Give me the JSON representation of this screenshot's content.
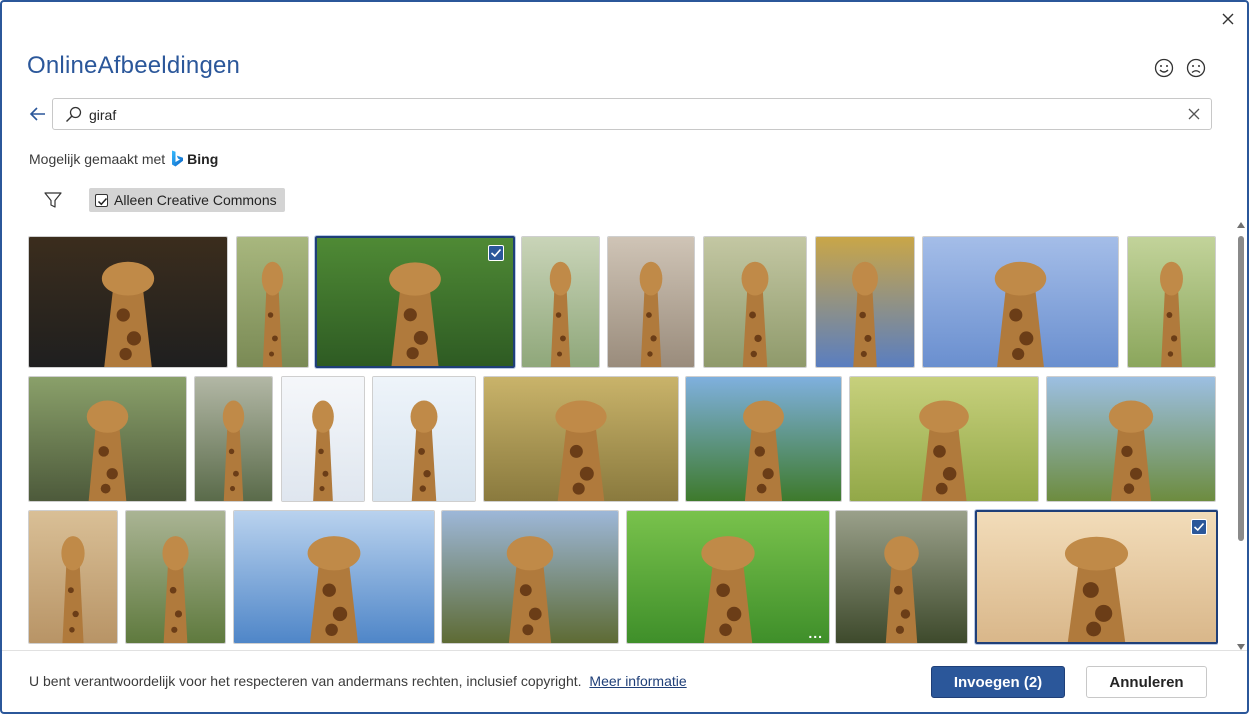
{
  "dialog": {
    "title": "OnlineAfbeeldingen",
    "close_icon": "close-icon",
    "feedback_positive_icon": "smiley-happy-icon",
    "feedback_negative_icon": "smiley-sad-icon"
  },
  "search": {
    "back_icon": "arrow-left-icon",
    "search_icon": "search-icon",
    "query": "giraf",
    "clear_icon": "close-icon"
  },
  "powered_by": {
    "text": "Mogelijk gemaakt met",
    "brand": "Bing"
  },
  "filters": {
    "filter_icon": "filter-icon",
    "creative_commons_label": "Alleen Creative Commons",
    "creative_commons_checked": true
  },
  "gallery": {
    "rows": [
      [
        {
          "subject": "giraffe head close-up",
          "selected": false
        },
        {
          "subject": "standing giraffe",
          "selected": false
        },
        {
          "subject": "giraffe face in trees",
          "selected": true
        },
        {
          "subject": "giraffe on grassland",
          "selected": false
        },
        {
          "subject": "giraffe neck",
          "selected": false
        },
        {
          "subject": "giraffe in savanna",
          "selected": false
        },
        {
          "subject": "two giraffes",
          "selected": false
        },
        {
          "subject": "giraffe against sky",
          "selected": false
        },
        {
          "subject": "giraffe resting",
          "selected": false
        }
      ],
      [
        {
          "subject": "giraffe head tilted",
          "selected": false
        },
        {
          "subject": "giraffe under tree",
          "selected": false
        },
        {
          "subject": "giraffe face",
          "selected": false
        },
        {
          "subject": "giraffe looking down",
          "selected": false
        },
        {
          "subject": "giraffe head side",
          "selected": false
        },
        {
          "subject": "giraffe in forest",
          "selected": false
        },
        {
          "subject": "two giraffe necks",
          "selected": false
        },
        {
          "subject": "giraffe by acacia",
          "selected": false
        }
      ],
      [
        {
          "subject": "young giraffe",
          "selected": false
        },
        {
          "subject": "giraffe near tree",
          "selected": false
        },
        {
          "subject": "giraffe head blue sky",
          "selected": false
        },
        {
          "subject": "giraffe behind tree",
          "selected": false
        },
        {
          "subject": "giraffe green background",
          "selected": false,
          "more": "..."
        },
        {
          "subject": "giraffes in forest",
          "selected": false
        },
        {
          "subject": "two giraffe heads",
          "selected": true
        }
      ]
    ]
  },
  "footer": {
    "disclaimer": "U bent verantwoordelijk voor het respecteren van andermans rechten, inclusief copyright.",
    "more_info_link": "Meer informatie",
    "insert_button": "Invoegen (2)",
    "cancel_button": "Annuleren"
  },
  "colors": {
    "accent": "#2b579a",
    "title": "#2b579a",
    "chip_bg": "#d4d4d4"
  }
}
